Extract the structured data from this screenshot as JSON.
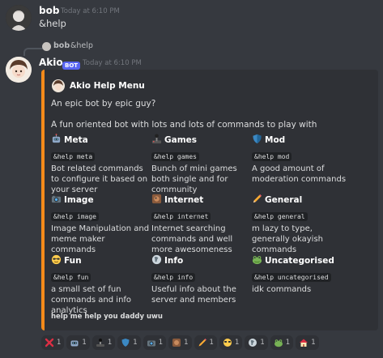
{
  "message_user": {
    "username": "bob",
    "timestamp": "Today at 6:10 PM",
    "text": "&help"
  },
  "reply_ref": {
    "username": "bob",
    "text": "&help"
  },
  "bot_message": {
    "username": "Akio",
    "badge": "BOT",
    "timestamp": "Today at 6:10 PM"
  },
  "embed": {
    "accent_color": "#f48a1a",
    "author": "Akio Help Menu",
    "description_1": "An epic bot by epic guy?",
    "description_2": "A fun oriented bot with lots and lots of commands to play with",
    "fields": [
      {
        "name": "Meta",
        "icon": "robot-icon",
        "code": "&help meta",
        "value": "Bot related commands to configure it based on your server"
      },
      {
        "name": "Games",
        "icon": "joystick-icon",
        "code": "&help games",
        "value": "Bunch of mini games both single and for community"
      },
      {
        "name": "Mod",
        "icon": "shield-icon",
        "code": "&help mod",
        "value": "A good amount of moderation commands"
      },
      {
        "name": "Image",
        "icon": "camera-icon",
        "code": "&help image",
        "value": "Image Manipulation and meme maker commands"
      },
      {
        "name": "Internet",
        "icon": "globe-icon",
        "code": "&help internet",
        "value": "Internet searching commands and well more awesomeness"
      },
      {
        "name": "General",
        "icon": "pencil-icon",
        "code": "&help general",
        "value": "m lazy to type, generally okayish commands"
      },
      {
        "name": "Fun",
        "icon": "sunglasses-face-icon",
        "code": "&help fun",
        "value": "a small set of fun commands and info analytics"
      },
      {
        "name": "Info",
        "icon": "info-icon",
        "code": "&help info",
        "value": "Useful info about the server and members"
      },
      {
        "name": "Uncategorised",
        "icon": "frog-icon",
        "code": "&help uncategorised",
        "value": "idk commands"
      }
    ],
    "footer": "help me help you daddy uwu"
  },
  "reactions": [
    {
      "icon": "x-icon",
      "count": "1"
    },
    {
      "icon": "robot-icon",
      "count": "1"
    },
    {
      "icon": "joystick-icon",
      "count": "1"
    },
    {
      "icon": "shield-icon",
      "count": "1"
    },
    {
      "icon": "camera-icon",
      "count": "1"
    },
    {
      "icon": "globe-icon",
      "count": "1"
    },
    {
      "icon": "pencil-icon",
      "count": "1"
    },
    {
      "icon": "sunglasses-face-icon",
      "count": "1"
    },
    {
      "icon": "info-icon",
      "count": "1"
    },
    {
      "icon": "frog-icon",
      "count": "1"
    },
    {
      "icon": "house-icon",
      "count": "1"
    }
  ]
}
